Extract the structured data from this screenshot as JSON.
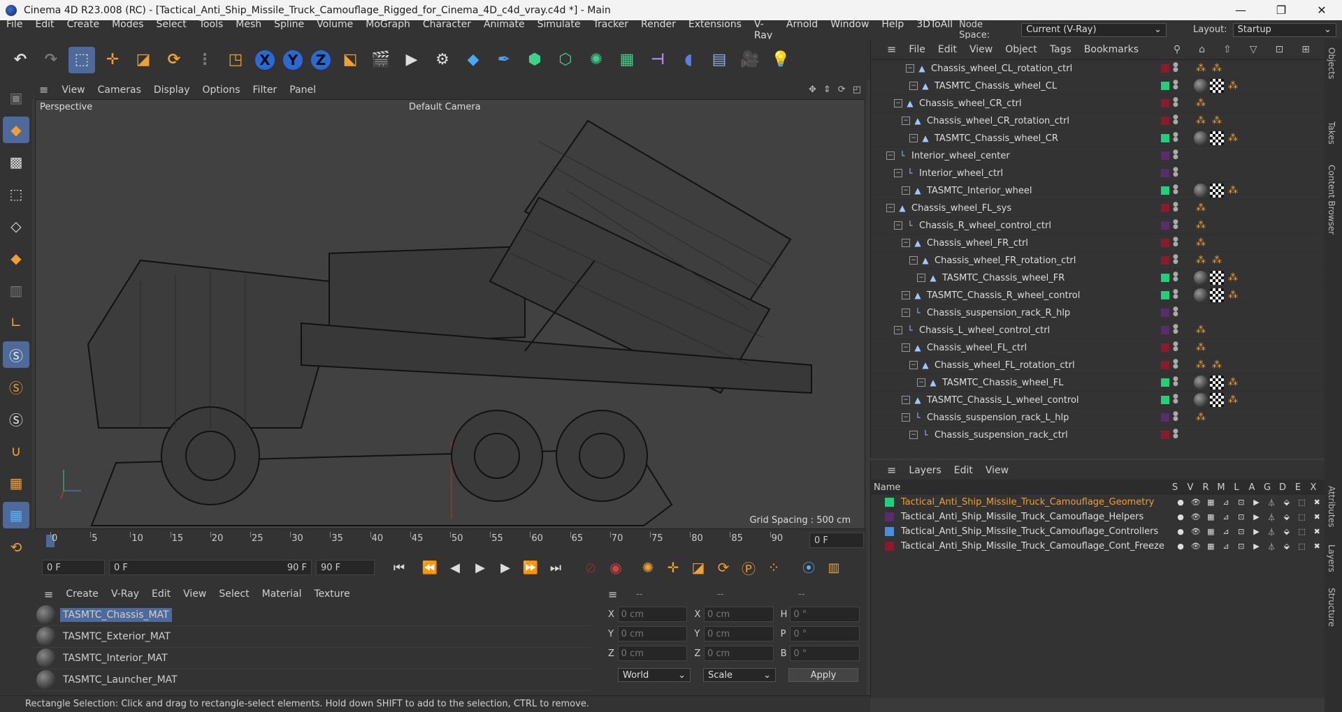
{
  "window": {
    "title": "Cinema 4D R23.008 (RC) - [Tactical_Anti_Ship_Missile_Truck_Camouflage_Rigged_for_Cinema_4D_c4d_vray.c4d *] - Main"
  },
  "menu": [
    "File",
    "Edit",
    "Create",
    "Modes",
    "Select",
    "Tools",
    "Mesh",
    "Spline",
    "Volume",
    "MoGraph",
    "Character",
    "Animate",
    "Simulate",
    "Tracker",
    "Render",
    "Extensions",
    "V-Ray",
    "Arnold",
    "Window",
    "Help",
    "3DToAll"
  ],
  "node_space": {
    "label": "Node Space:",
    "value": "Current (V-Ray)"
  },
  "layout": {
    "label": "Layout:",
    "value": "Startup"
  },
  "axes": [
    "X",
    "Y",
    "Z"
  ],
  "viewport": {
    "menu": [
      "View",
      "Cameras",
      "Display",
      "Options",
      "Filter",
      "Panel"
    ],
    "label": "Perspective",
    "camera": "Default Camera",
    "grid_spacing": "Grid Spacing : 500 cm"
  },
  "timeline": {
    "ticks": [
      "0",
      "5",
      "10",
      "15",
      "20",
      "25",
      "30",
      "35",
      "40",
      "45",
      "50",
      "55",
      "60",
      "65",
      "70",
      "75",
      "80",
      "85",
      "90"
    ],
    "current": "0 F"
  },
  "transport": {
    "start": "0 F",
    "range_start": "0 F",
    "range_end": "90 F",
    "end": "90 F"
  },
  "materials": {
    "menu": [
      "Create",
      "V-Ray",
      "Edit",
      "View",
      "Select",
      "Material",
      "Texture"
    ],
    "items": [
      "TASMTC_Chassis_MAT",
      "TASMTC_Exterior_MAT",
      "TASMTC_Interior_MAT",
      "TASMTC_Launcher_MAT"
    ]
  },
  "coords": {
    "headers": [
      "--",
      "--",
      "--"
    ],
    "rows": [
      {
        "a": "X",
        "av": "0 cm",
        "b": "X",
        "bv": "0 cm",
        "c": "H",
        "cv": "0 °"
      },
      {
        "a": "Y",
        "av": "0 cm",
        "b": "Y",
        "bv": "0 cm",
        "c": "P",
        "cv": "0 °"
      },
      {
        "a": "Z",
        "av": "0 cm",
        "b": "Z",
        "bv": "0 cm",
        "c": "B",
        "cv": "0 °"
      }
    ],
    "mode": "World",
    "scale": "Scale",
    "apply": "Apply"
  },
  "status": "Rectangle Selection: Click and drag to rectangle-select elements. Hold down SHIFT to add to the selection, CTRL to remove.",
  "objects": {
    "menu": [
      "File",
      "Edit",
      "View",
      "Object",
      "Tags",
      "Bookmarks"
    ],
    "rows": [
      {
        "name": "Chassis_wheel_CL_rotation_ctrl",
        "indent": 4,
        "color": "#8a1b2e",
        "icon": "joint",
        "tags": [
          "org",
          "org"
        ]
      },
      {
        "name": "TASMTC_Chassis_wheel_CL",
        "indent": 5,
        "color": "#22d07a",
        "icon": "joint",
        "tags": [
          "ball",
          "chk",
          "org"
        ]
      },
      {
        "name": "Chassis_wheel_CR_ctrl",
        "indent": 3,
        "color": "#8a1b2e",
        "icon": "joint",
        "tags": [
          "org"
        ]
      },
      {
        "name": "Chassis_wheel_CR_rotation_ctrl",
        "indent": 4,
        "color": "#8a1b2e",
        "icon": "joint",
        "tags": [
          "org",
          "org"
        ]
      },
      {
        "name": "TASMTC_Chassis_wheel_CR",
        "indent": 5,
        "color": "#22d07a",
        "icon": "joint",
        "tags": [
          "ball",
          "chk",
          "org"
        ]
      },
      {
        "name": "Interior_wheel_center",
        "indent": 2,
        "color": "#5a2c6e",
        "icon": "null",
        "tags": []
      },
      {
        "name": "Interior_wheel_ctrl",
        "indent": 3,
        "color": "#5a2c6e",
        "icon": "null",
        "tags": []
      },
      {
        "name": "TASMTC_Interior_wheel",
        "indent": 4,
        "color": "#22d07a",
        "icon": "joint",
        "tags": [
          "ball",
          "chk",
          "org"
        ]
      },
      {
        "name": "Chassis_wheel_FL_sys",
        "indent": 2,
        "color": "#8a1b2e",
        "icon": "joint",
        "tags": [
          "org"
        ]
      },
      {
        "name": "Chassis_R_wheel_control_ctrl",
        "indent": 3,
        "color": "#5a2c6e",
        "icon": "null",
        "tags": [
          "org"
        ]
      },
      {
        "name": "Chassis_wheel_FR_ctrl",
        "indent": 4,
        "color": "#8a1b2e",
        "icon": "joint",
        "tags": [
          "org"
        ]
      },
      {
        "name": "Chassis_wheel_FR_rotation_ctrl",
        "indent": 5,
        "color": "#8a1b2e",
        "icon": "joint",
        "tags": [
          "org",
          "org"
        ]
      },
      {
        "name": "TASMTC_Chassis_wheel_FR",
        "indent": 6,
        "color": "#22d07a",
        "icon": "joint",
        "tags": [
          "ball",
          "chk",
          "org"
        ]
      },
      {
        "name": "TASMTC_Chassis_R_wheel_control",
        "indent": 4,
        "color": "#22d07a",
        "icon": "joint",
        "tags": [
          "ball",
          "chk",
          "org"
        ]
      },
      {
        "name": "Chassis_suspension_rack_R_hlp",
        "indent": 4,
        "color": "#5a2c6e",
        "icon": "null",
        "tags": []
      },
      {
        "name": "Chassis_L_wheel_control_ctrl",
        "indent": 3,
        "color": "#5a2c6e",
        "icon": "null",
        "tags": [
          "org"
        ]
      },
      {
        "name": "Chassis_wheel_FL_ctrl",
        "indent": 4,
        "color": "#8a1b2e",
        "icon": "joint",
        "tags": [
          "org"
        ]
      },
      {
        "name": "Chassis_wheel_FL_rotation_ctrl",
        "indent": 5,
        "color": "#8a1b2e",
        "icon": "joint",
        "tags": [
          "org",
          "org"
        ]
      },
      {
        "name": "TASMTC_Chassis_wheel_FL",
        "indent": 6,
        "color": "#22d07a",
        "icon": "joint",
        "tags": [
          "ball",
          "chk",
          "org"
        ]
      },
      {
        "name": "TASMTC_Chassis_L_wheel_control",
        "indent": 4,
        "color": "#22d07a",
        "icon": "joint",
        "tags": [
          "ball",
          "chk",
          "org"
        ]
      },
      {
        "name": "Chassis_suspension_rack_L_hlp",
        "indent": 4,
        "color": "#5a2c6e",
        "icon": "null",
        "tags": [
          "org"
        ]
      },
      {
        "name": "Chassis_suspension_rack_ctrl",
        "indent": 5,
        "color": "#8a1b2e",
        "icon": "null",
        "tags": []
      }
    ]
  },
  "layers": {
    "menu": [
      "Layers",
      "Edit",
      "View"
    ],
    "name_header": "Name",
    "cols": [
      "S",
      "V",
      "R",
      "M",
      "L",
      "A",
      "G",
      "D",
      "E",
      "X"
    ],
    "items": [
      {
        "name": "Tactical_Anti_Ship_Missile_Truck_Camouflage_Geometry",
        "color": "#22d07a",
        "active": true
      },
      {
        "name": "Tactical_Anti_Ship_Missile_Truck_Camouflage_Helpers",
        "color": "#5a2c6e",
        "active": false
      },
      {
        "name": "Tactical_Anti_Ship_Missile_Truck_Camouflage_Controllers",
        "color": "#4a8fd8",
        "active": false
      },
      {
        "name": "Tactical_Anti_Ship_Missile_Truck_Camouflage_Cont_Freeze",
        "color": "#8a1b2e",
        "active": false
      }
    ]
  },
  "right_tabs": [
    "Objects",
    "Takes",
    "Content Browser",
    "Attributes",
    "Layers",
    "Structure"
  ]
}
